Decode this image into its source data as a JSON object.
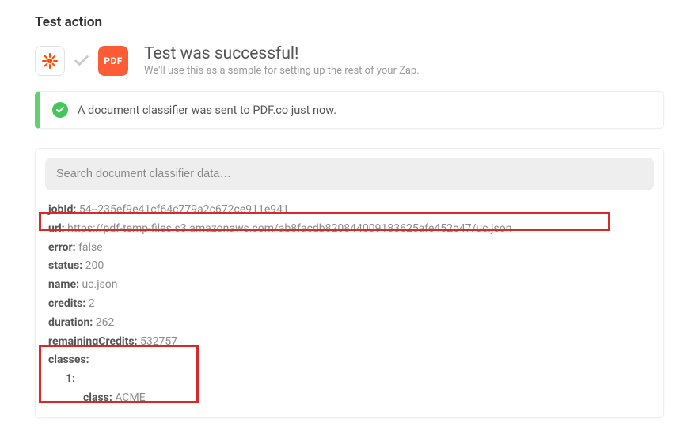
{
  "heading": "Test action",
  "icons": {
    "zap": "zap-spokes-icon",
    "pdf_label": "PDF"
  },
  "header": {
    "title": "Test was successful!",
    "subtitle": "We'll use this as a sample for setting up the rest of your Zap."
  },
  "alert": {
    "message": "A document classifier was sent to PDF.co just now."
  },
  "search": {
    "placeholder": "Search document classifier data…"
  },
  "result": {
    "jobId": {
      "k": "jobId:",
      "v": "54--235ef9e41cf64c779a2c672ce911e941"
    },
    "url": {
      "k": "url:",
      "v": "https://pdf-temp-files.s3.amazonaws.com/ab8facdb820844009183625afe452b47/uc.json"
    },
    "error": {
      "k": "error:",
      "v": "false"
    },
    "status": {
      "k": "status:",
      "v": "200"
    },
    "name": {
      "k": "name:",
      "v": "uc.json"
    },
    "credits": {
      "k": "credits:",
      "v": "2"
    },
    "duration": {
      "k": "duration:",
      "v": "262"
    },
    "remainingCredits": {
      "k": "remainingCredits:",
      "v": "532757"
    },
    "classes": {
      "k": "classes:"
    },
    "classes_1": {
      "k": "1:"
    },
    "classes_1_class": {
      "k": "class:",
      "v": "ACME"
    }
  }
}
